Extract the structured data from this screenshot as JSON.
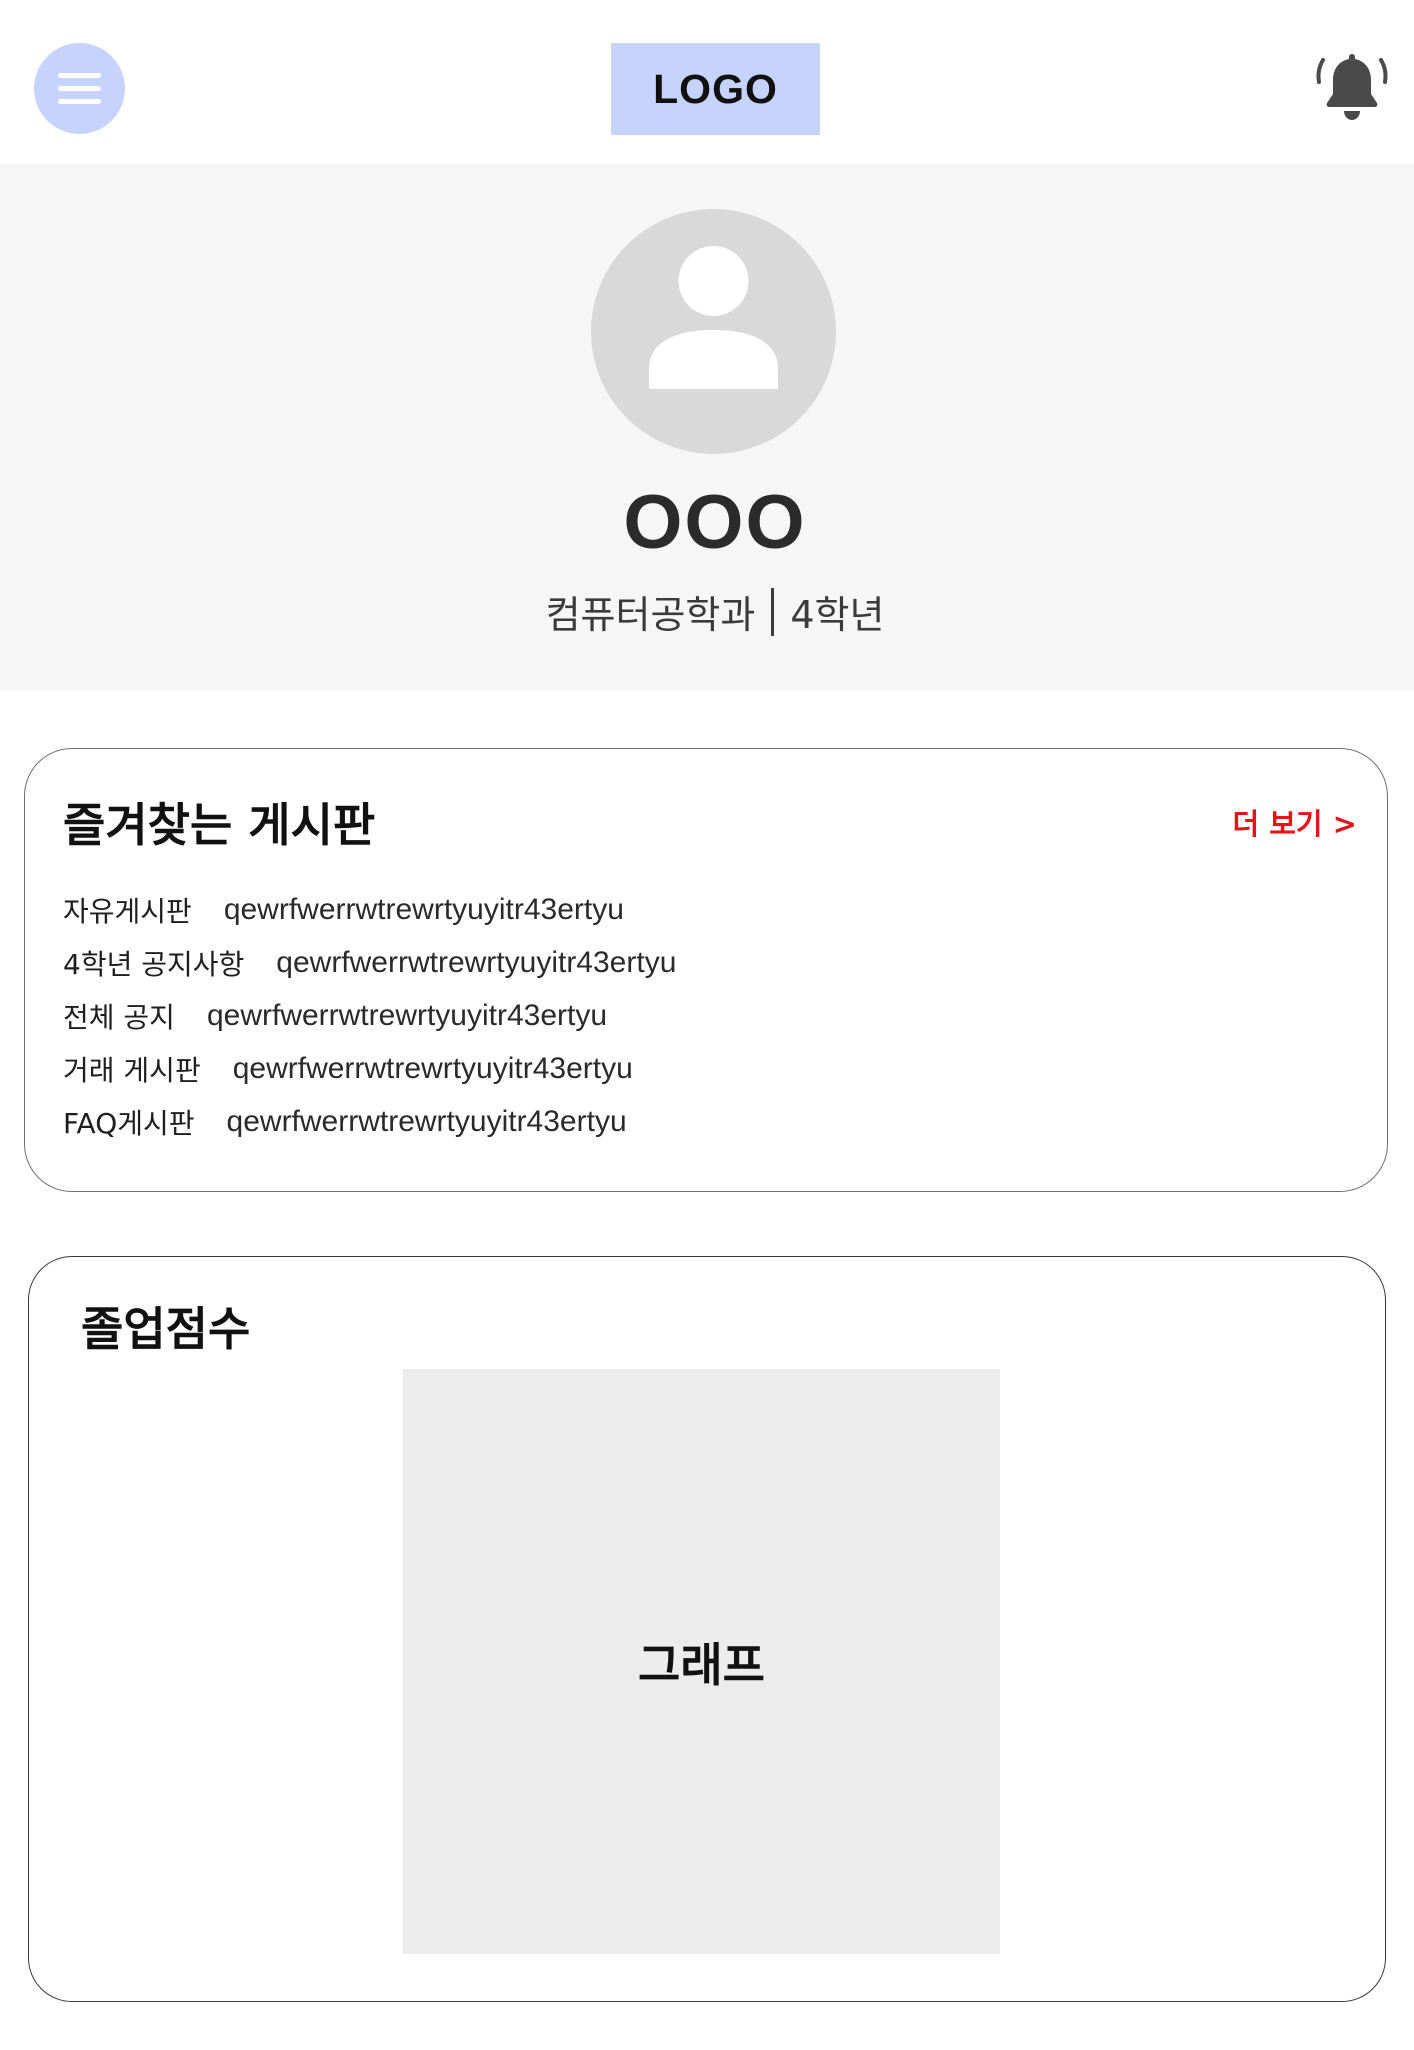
{
  "header": {
    "logo_text": "LOGO",
    "menu_icon": "hamburger-menu-icon",
    "notification_icon": "bell-icon",
    "accent_color": "#c5d3fd"
  },
  "profile": {
    "avatar_icon": "user-placeholder-icon",
    "name": "OOO",
    "department": "컴퓨터공학과",
    "grade": "4학년"
  },
  "favorites": {
    "title": "즐겨찾는 게시판",
    "more_label": "더 보기 >",
    "more_color": "#e8121b",
    "items": [
      {
        "board": "자유게시판",
        "preview": "qewrfwerrwtrewrtyuyitr43ertyu"
      },
      {
        "board": "4학년 공지사항",
        "preview": "qewrfwerrwtrewrtyuyitr43ertyu"
      },
      {
        "board": "전체 공지",
        "preview": "qewrfwerrwtrewrtyuyitr43ertyu"
      },
      {
        "board": "거래 게시판",
        "preview": "qewrfwerrwtrewrtyuyitr43ertyu"
      },
      {
        "board": "FAQ게시판",
        "preview": "qewrfwerrwtrewrtyuyitr43ertyu"
      }
    ]
  },
  "graduation": {
    "title": "졸업점수",
    "graph_label": "그래프"
  }
}
